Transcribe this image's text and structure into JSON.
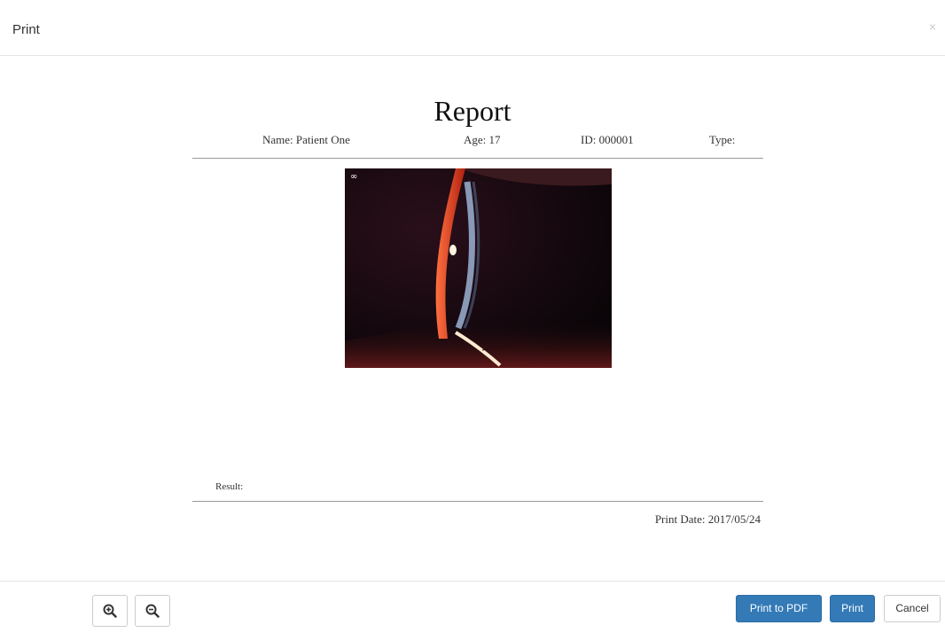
{
  "dialog": {
    "title": "Print",
    "close_glyph": "×"
  },
  "report": {
    "title": "Report",
    "fields": {
      "name": "Name: Patient One",
      "age": "Age: 17",
      "id": "ID: 000001",
      "type": "Type:"
    },
    "photo_overlay": "∞",
    "result_label": "Result:",
    "print_date": "Print Date: 2017/05/24"
  },
  "footer": {
    "zoom_in_icon": "zoom-in-icon",
    "zoom_out_icon": "zoom-out-icon",
    "print_pdf_label": "Print to PDF",
    "print_label": "Print",
    "cancel_label": "Cancel"
  },
  "colors": {
    "primary": "#337ab7",
    "border": "#cccccc"
  }
}
